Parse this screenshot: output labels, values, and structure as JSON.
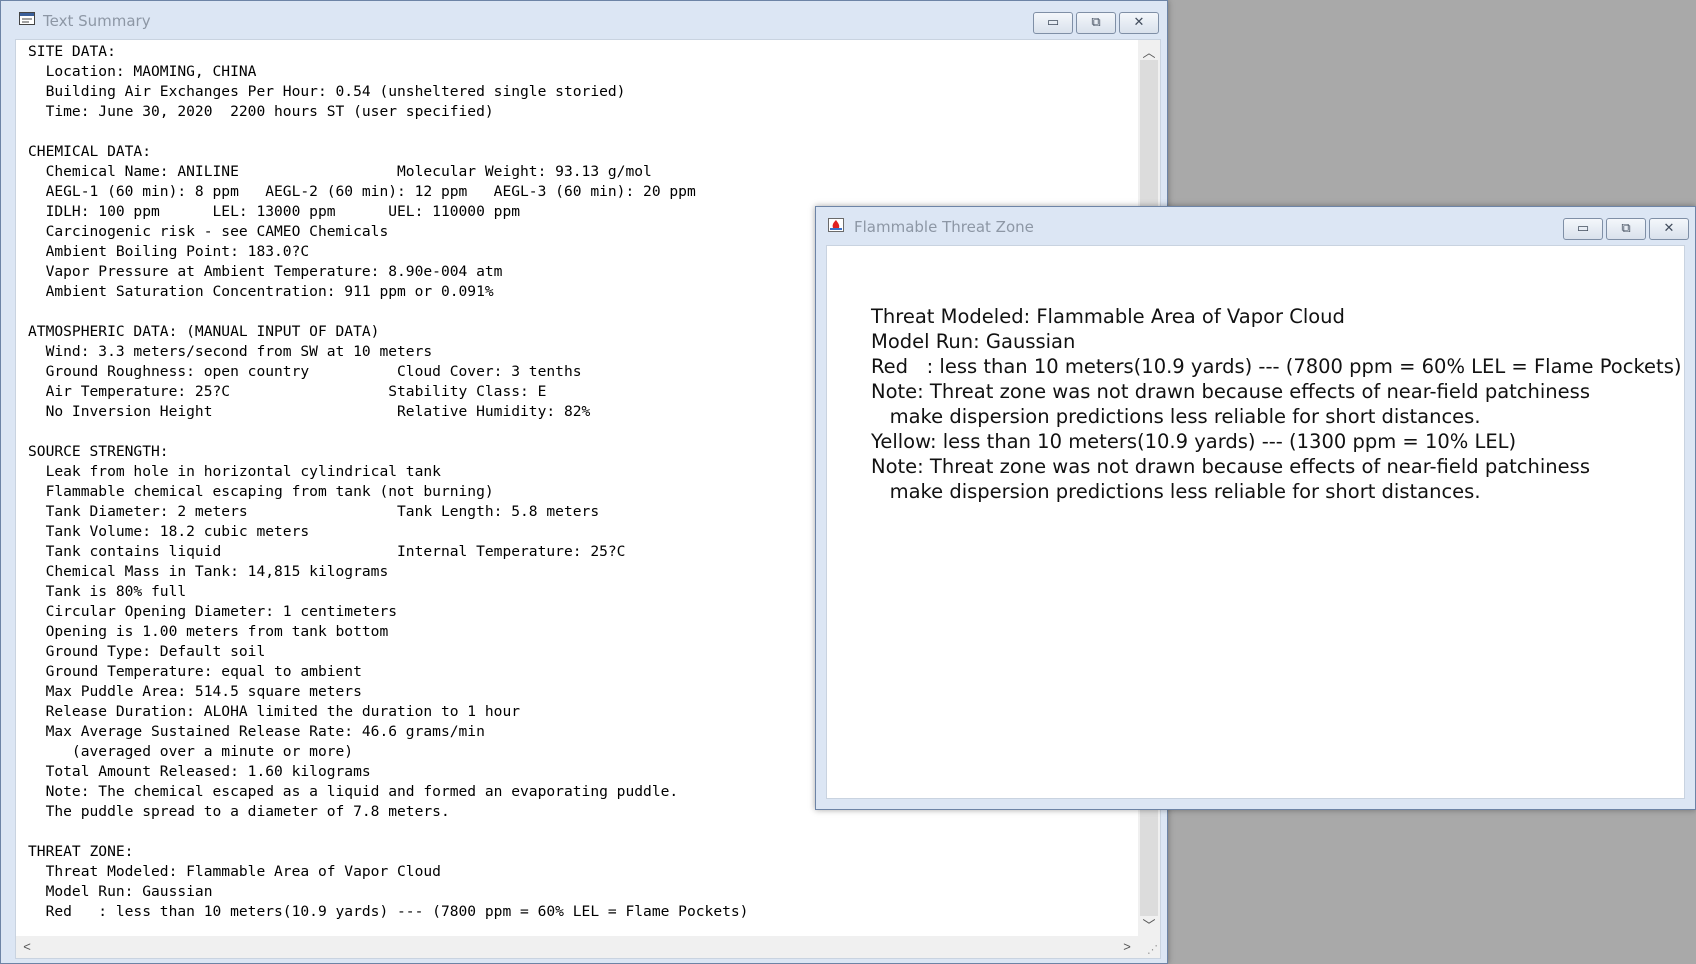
{
  "text_summary": {
    "title": "Text Summary",
    "icon": "document-icon",
    "controls": {
      "minimize": "▭",
      "maximize": "⧉",
      "close": "✕"
    },
    "content": "SITE DATA:\n  Location: MAOMING, CHINA\n  Building Air Exchanges Per Hour: 0.54 (unsheltered single storied)\n  Time: June 30, 2020  2200 hours ST (user specified)\n\nCHEMICAL DATA:\n  Chemical Name: ANILINE                  Molecular Weight: 93.13 g/mol\n  AEGL-1 (60 min): 8 ppm   AEGL-2 (60 min): 12 ppm   AEGL-3 (60 min): 20 ppm\n  IDLH: 100 ppm      LEL: 13000 ppm      UEL: 110000 ppm\n  Carcinogenic risk - see CAMEO Chemicals\n  Ambient Boiling Point: 183.0?C\n  Vapor Pressure at Ambient Temperature: 8.90e-004 atm\n  Ambient Saturation Concentration: 911 ppm or 0.091%\n\nATMOSPHERIC DATA: (MANUAL INPUT OF DATA)\n  Wind: 3.3 meters/second from SW at 10 meters\n  Ground Roughness: open country          Cloud Cover: 3 tenths\n  Air Temperature: 25?C                  Stability Class: E\n  No Inversion Height                     Relative Humidity: 82%\n\nSOURCE STRENGTH:\n  Leak from hole in horizontal cylindrical tank\n  Flammable chemical escaping from tank (not burning)\n  Tank Diameter: 2 meters                 Tank Length: 5.8 meters\n  Tank Volume: 18.2 cubic meters\n  Tank contains liquid                    Internal Temperature: 25?C\n  Chemical Mass in Tank: 14,815 kilograms\n  Tank is 80% full\n  Circular Opening Diameter: 1 centimeters\n  Opening is 1.00 meters from tank bottom\n  Ground Type: Default soil\n  Ground Temperature: equal to ambient\n  Max Puddle Area: 514.5 square meters\n  Release Duration: ALOHA limited the duration to 1 hour\n  Max Average Sustained Release Rate: 46.6 grams/min\n     (averaged over a minute or more)\n  Total Amount Released: 1.60 kilograms\n  Note: The chemical escaped as a liquid and formed an evaporating puddle.\n  The puddle spread to a diameter of 7.8 meters.\n\nTHREAT ZONE:\n  Threat Modeled: Flammable Area of Vapor Cloud\n  Model Run: Gaussian\n  Red   : less than 10 meters(10.9 yards) --- (7800 ppm = 60% LEL = Flame Pockets)",
    "scroll": {
      "up": "︿",
      "down": "﹀",
      "left": "<",
      "right": ">"
    }
  },
  "threat_zone": {
    "title": "Flammable Threat Zone",
    "icon": "flame-app-icon",
    "controls": {
      "minimize": "▭",
      "maximize": "⧉",
      "close": "✕"
    },
    "content": "Threat Modeled: Flammable Area of Vapor Cloud\nModel Run: Gaussian\nRed   : less than 10 meters(10.9 yards) --- (7800 ppm = 60% LEL = Flame Pockets)\nNote: Threat zone was not drawn because effects of near-field patchiness\n   make dispersion predictions less reliable for short distances.\nYellow: less than 10 meters(10.9 yards) --- (1300 ppm = 10% LEL)\nNote: Threat zone was not drawn because effects of near-field patchiness\n   make dispersion predictions less reliable for short distances."
  }
}
